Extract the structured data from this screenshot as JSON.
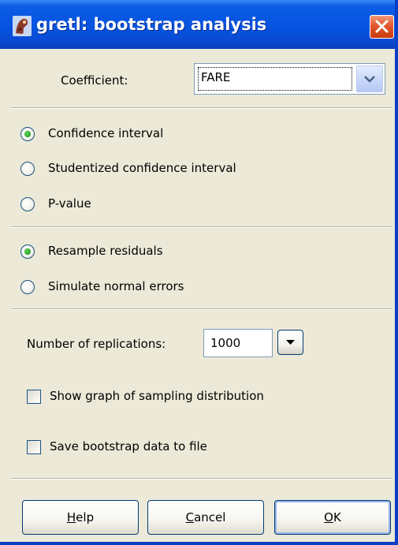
{
  "window": {
    "title": "gretl: bootstrap analysis",
    "app_icon": "gretl-icon",
    "close_icon": "close-icon"
  },
  "coefficient": {
    "label": "Coefficient:",
    "selected": "FARE"
  },
  "interval_options": [
    {
      "label": "Confidence interval",
      "checked": true
    },
    {
      "label": "Studentized confidence interval",
      "checked": false
    },
    {
      "label": "P-value",
      "checked": false
    }
  ],
  "resample_options": [
    {
      "label": "Resample residuals",
      "checked": true
    },
    {
      "label": "Simulate normal errors",
      "checked": false
    }
  ],
  "replications": {
    "label": "Number of replications:",
    "value": "1000"
  },
  "checkboxes": [
    {
      "label": "Show graph of sampling distribution",
      "checked": false
    },
    {
      "label": "Save bootstrap data to file",
      "checked": false
    }
  ],
  "buttons": {
    "help": {
      "label": "Help",
      "mnemonic": "H",
      "rest": "elp"
    },
    "cancel": {
      "label": "Cancel",
      "mnemonic": "C",
      "rest": "ancel"
    },
    "ok": {
      "label": "OK",
      "mnemonic": "O",
      "rest": "K"
    }
  },
  "colors": {
    "titlebar": "#0553e0",
    "dialog_bg": "#ece9d8",
    "radio_checked": "#21a121",
    "close_button": "#e2572c"
  }
}
